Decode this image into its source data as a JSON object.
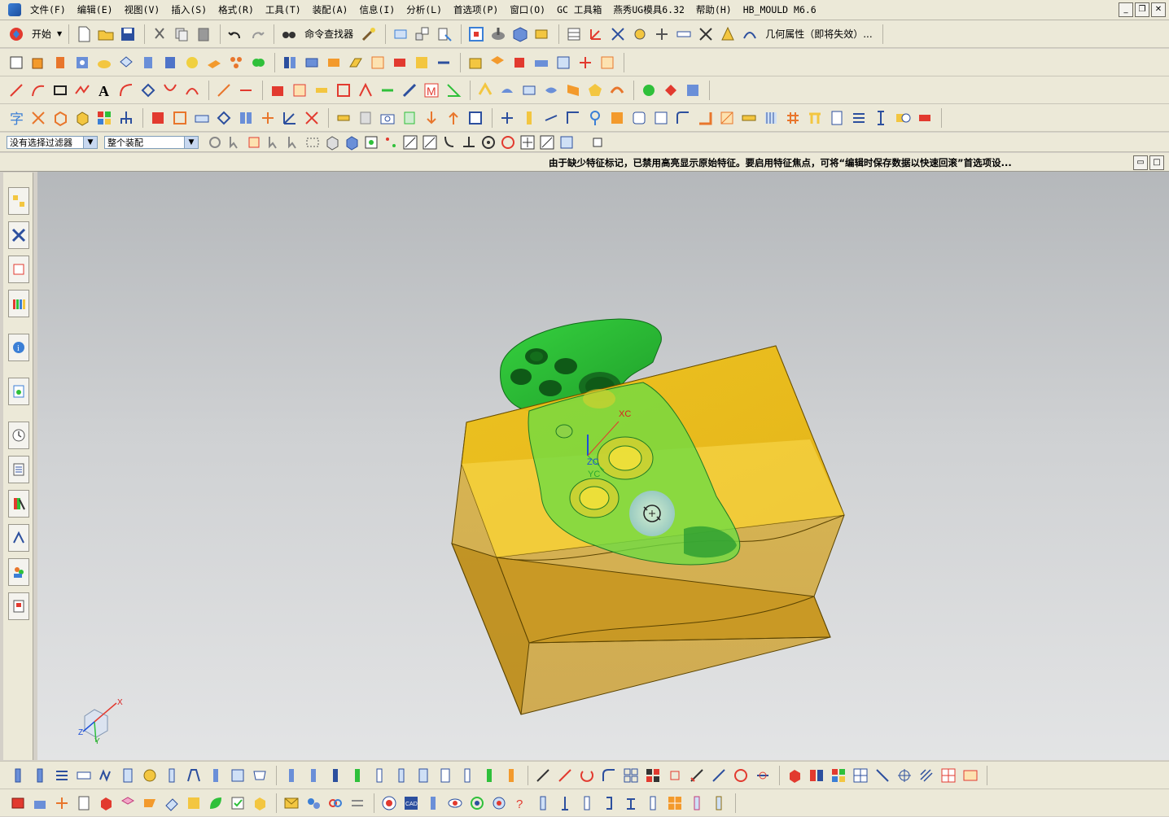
{
  "menu": {
    "items": [
      "文件(F)",
      "编辑(E)",
      "视图(V)",
      "插入(S)",
      "格式(R)",
      "工具(T)",
      "装配(A)",
      "信息(I)",
      "分析(L)",
      "首选项(P)",
      "窗口(O)",
      "GC 工具箱",
      "燕秀UG模具6.32",
      "帮助(H)",
      "HB_MOULD M6.6"
    ]
  },
  "toolbar1": {
    "start_label": "开始",
    "command_finder_label": "命令查找器",
    "geometry_properties_label": "几何属性（即将失效）..."
  },
  "selection_bar": {
    "filter_value": "没有选择过滤器",
    "scope_value": "整个装配"
  },
  "status": {
    "message": "由于缺少特征标记，已禁用高亮显示原始特征。要启用特征焦点，可将“编辑时保存数据以快速回滚”首选项设..."
  },
  "viewport": {
    "wcs_x": "XC",
    "wcs_y": "YC",
    "wcs_z": "ZC",
    "triad_x": "X",
    "triad_y": "Y",
    "triad_z": "Z"
  },
  "colors": {
    "block_front": "#e0b020",
    "block_top": "#f0c418",
    "part_green": "#2fc03a",
    "background_top": "#b5b8bb",
    "background_bottom": "#e3e4e5"
  }
}
